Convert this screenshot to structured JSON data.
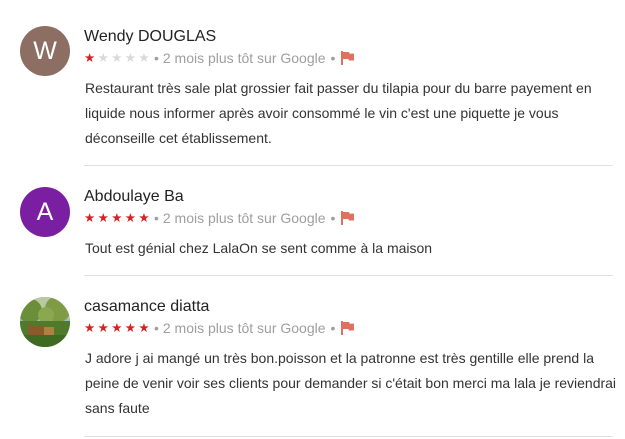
{
  "reviews": [
    {
      "author": "Wendy DOUGLAS",
      "avatar_letter": "W",
      "avatar_color": "#8d6e63",
      "rating": 1,
      "max_rating": 5,
      "time": "2 mois plus tôt sur Google",
      "text": "Restaurant très sale plat grossier fait passer du tilapia pour du barre payement en liquide nous informer après avoir consommé le vin c'est une piquette je vous déconseille cet établissement.",
      "flag_icon": "flag-icon"
    },
    {
      "author": "Abdoulaye Ba",
      "avatar_letter": "A",
      "avatar_color": "#7b1fa2",
      "rating": 5,
      "max_rating": 5,
      "time": "2 mois plus tôt sur Google",
      "text": "Tout est génial chez LalaOn se sent comme à la maison",
      "flag_icon": "flag-icon"
    },
    {
      "author": "casamance diatta",
      "avatar_letter": "",
      "avatar_color": "#5a7a3a",
      "rating": 5,
      "max_rating": 5,
      "time": "2 mois plus tôt sur Google",
      "text": "J adore j ai mangé un très bon.poisson et la patronne est très gentille elle prend la peine de venir voir ses clients pour demander si c'était bon merci ma lala je reviendrai sans faute",
      "flag_icon": "flag-icon"
    }
  ],
  "colors": {
    "star_on": "#d32323",
    "star_off": "#d9d9d9",
    "flag": "#e0705f",
    "meta_text": "#9e9e9e",
    "divider": "#e0e0e0"
  }
}
